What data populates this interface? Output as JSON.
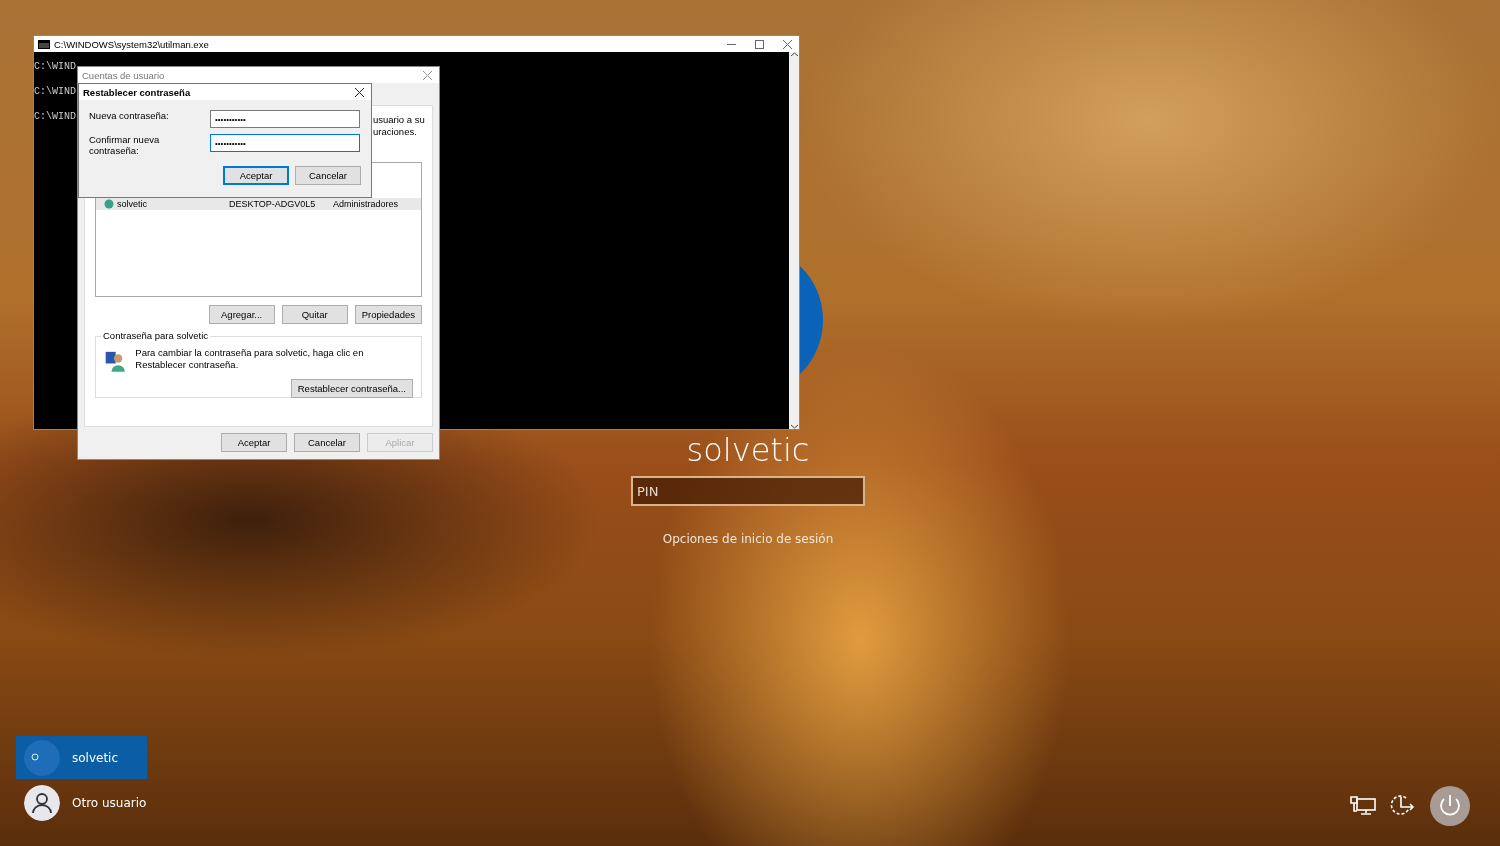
{
  "lock_screen": {
    "username": "solvetic",
    "pin_field": {
      "placeholder": "PIN"
    },
    "sign_in_options": "Opciones de inicio de sesión"
  },
  "user_list": [
    {
      "name": "solvetic",
      "selected": true
    },
    {
      "name": "Otro usuario",
      "selected": false
    }
  ],
  "console_window": {
    "title": "C:\\WINDOWS\\system32\\utilman.exe",
    "lines": [
      "C:\\WIND",
      "C:\\WIND",
      "C:\\WIND"
    ]
  },
  "user_accounts_dialog": {
    "title": "Cuentas de usuario",
    "intro_lines": [
      "usuario a su",
      "uraciones."
    ],
    "users_table": {
      "rows": [
        {
          "column_1": "solvetic",
          "column_2": "DESKTOP-ADGV0L5",
          "column_3": "Administradores",
          "selected": true
        }
      ]
    },
    "list_buttons": [
      "Agregar...",
      "Quitar",
      "Propiedades"
    ],
    "password_group": {
      "title": "Contraseña para solvetic",
      "text": "Para cambiar la contraseña para solvetic, haga clic en Restablecer contraseña.",
      "button": "Restablecer contraseña..."
    },
    "footer_buttons": [
      {
        "label": "Aceptar",
        "disabled": false
      },
      {
        "label": "Cancelar",
        "disabled": false
      },
      {
        "label": "Aplicar",
        "disabled": true
      }
    ]
  },
  "reset_dialog": {
    "title": "Restablecer contraseña",
    "fields": [
      {
        "label": "Nueva contraseña:",
        "value": "•••••••••••",
        "focused": false
      },
      {
        "label": "Confirmar nueva contraseña:",
        "value": "•••••••••••",
        "focused": true
      }
    ],
    "buttons": [
      {
        "label": "Aceptar",
        "default": true
      },
      {
        "label": "Cancelar",
        "default": false
      }
    ]
  }
}
